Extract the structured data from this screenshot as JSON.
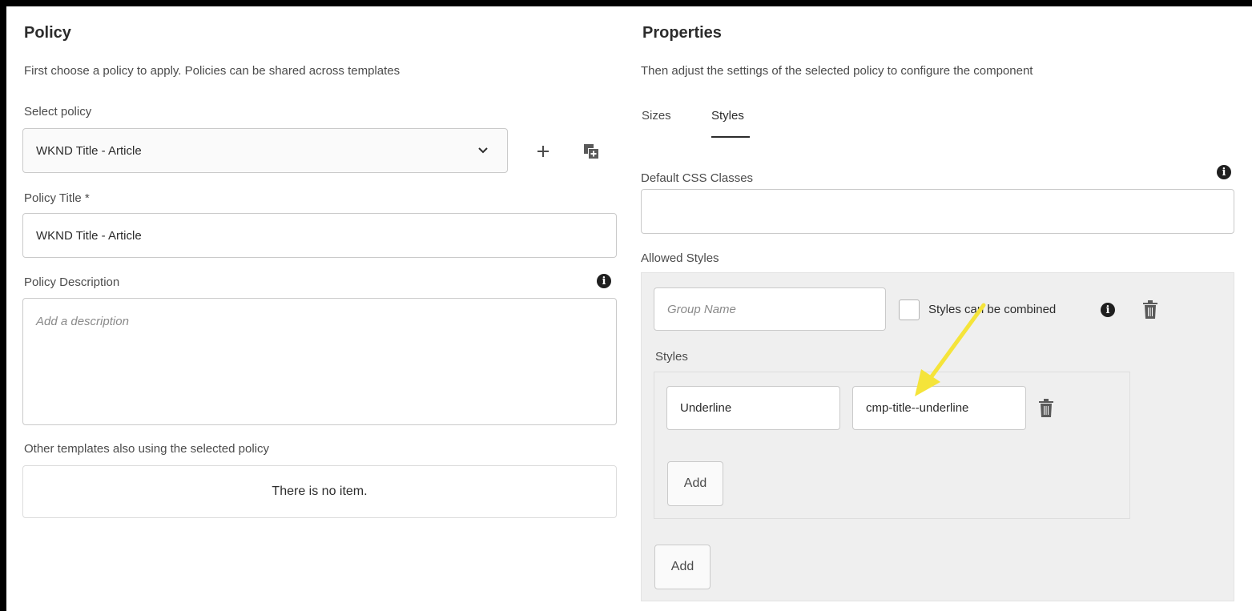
{
  "policy": {
    "heading": "Policy",
    "description": "First choose a policy to apply. Policies can be shared across templates",
    "select_label": "Select policy",
    "selected_policy": "WKND Title - Article",
    "title_label": "Policy Title *",
    "title_value": "WKND Title - Article",
    "description_label": "Policy Description",
    "description_placeholder": "Add a description",
    "other_templates_label": "Other templates also using the selected policy",
    "other_templates_empty": "There is no item."
  },
  "properties": {
    "heading": "Properties",
    "description": "Then adjust the settings of the selected policy to configure the component",
    "tabs": [
      {
        "label": "Sizes",
        "active": false
      },
      {
        "label": "Styles",
        "active": true
      }
    ],
    "default_css_label": "Default CSS Classes",
    "default_css_value": "",
    "allowed_styles_label": "Allowed Styles",
    "group_name_placeholder": "Group Name",
    "combine_label": "Styles can be combined",
    "styles_label": "Styles",
    "style_name": "Underline",
    "style_class": "cmp-title--underline",
    "add_inner_label": "Add",
    "add_outer_label": "Add"
  },
  "icons": {
    "add": "plus-icon",
    "copy": "duplicate-icon",
    "dropdown": "chevron-down-icon",
    "info": "info-icon",
    "delete": "trash-icon",
    "annotation": "yellow-arrow"
  },
  "colors": {
    "annotation_arrow": "#f5e43a",
    "panel_background": "#efefef"
  }
}
